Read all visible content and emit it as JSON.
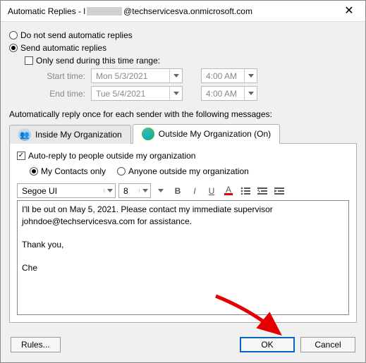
{
  "window": {
    "title_prefix": "Automatic Replies - l",
    "title_suffix": "@techservicesva.onmicrosoft.com"
  },
  "options": {
    "do_not_send": "Do not send automatic replies",
    "send": "Send automatic replies",
    "range_check": "Only send during this time range:",
    "start_label": "Start time:",
    "start_date": "Mon 5/3/2021",
    "start_time": "4:00 AM",
    "end_label": "End time:",
    "end_date": "Tue 5/4/2021",
    "end_time": "4:00 AM"
  },
  "section_msg": "Automatically reply once for each sender with the following messages:",
  "tabs": {
    "inside": "Inside My Organization",
    "outside": "Outside My Organization (On)"
  },
  "outside": {
    "auto_reply_check": "Auto-reply to people outside my organization",
    "contacts_only": "My Contacts only",
    "anyone": "Anyone outside my organization"
  },
  "toolbar": {
    "font": "Segoe UI",
    "size": "8"
  },
  "message": {
    "line1": "I'll be out on May 5, 2021. Please contact my immediate supervisor",
    "line2": "johndoe@techservicesva.com for assistance.",
    "line3": "Thank you,",
    "line4": "Che"
  },
  "buttons": {
    "rules": "Rules...",
    "ok": "OK",
    "cancel": "Cancel"
  }
}
